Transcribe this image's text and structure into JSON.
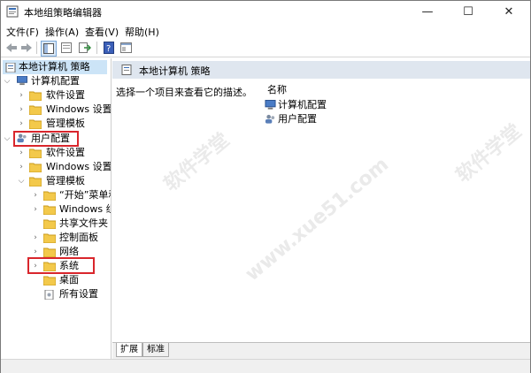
{
  "window": {
    "title": "本地组策略编辑器",
    "controls": {
      "minimize": "—",
      "maximize": "☐",
      "close": "✕"
    }
  },
  "menu": [
    "文件(F)",
    "操作(A)",
    "查看(V)",
    "帮助(H)"
  ],
  "toolbar": {
    "icons": [
      "back-arrow-icon",
      "forward-arrow-icon",
      "show-hide-tree-icon",
      "properties-icon",
      "export-list-icon",
      "help-icon",
      "extended-view-icon"
    ]
  },
  "tree": {
    "root": "本地计算机 策略",
    "computer_config": "计算机配置",
    "computer_children": [
      "软件设置",
      "Windows 设置",
      "管理模板"
    ],
    "user_config": "用户配置",
    "user_children": [
      "软件设置",
      "Windows 设置",
      "管理模板"
    ],
    "admin_templates_children": [
      "“开始”菜单和",
      "Windows 组",
      "共享文件夹",
      "控制面板",
      "网络",
      "系统",
      "桌面",
      "所有设置"
    ]
  },
  "right_pane": {
    "header": "本地计算机 策略",
    "description": "选择一个项目来查看它的描述。",
    "column_name": "名称",
    "items": [
      "计算机配置",
      "用户配置"
    ]
  },
  "tabs": [
    "扩展",
    "标准"
  ],
  "colors": {
    "highlight": "#d9262c",
    "folder": "#f3c94b",
    "header_bg": "#dfe6ef"
  },
  "watermark": [
    "软件学堂",
    "www.xue51.com",
    "软件学堂"
  ]
}
